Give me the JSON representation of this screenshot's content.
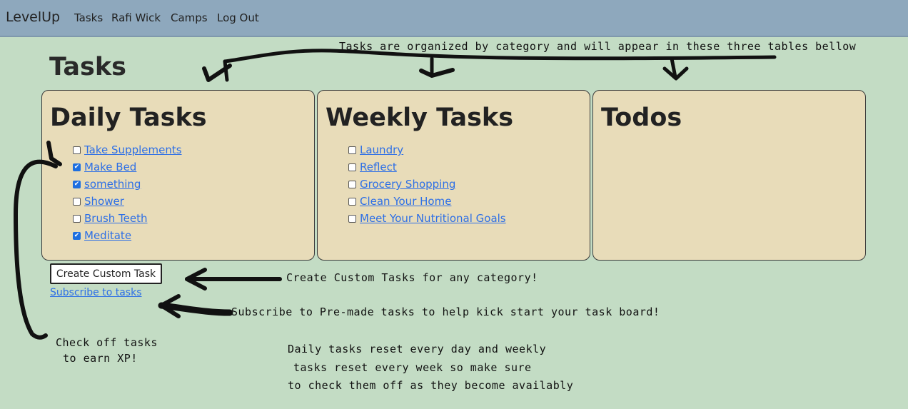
{
  "navbar": {
    "brand": "LevelUp",
    "links": [
      "Tasks",
      "Rafi Wick",
      "Camps",
      "Log Out"
    ]
  },
  "page": {
    "title": "Tasks"
  },
  "panels": {
    "daily": {
      "title": "Daily Tasks",
      "tasks": [
        {
          "label": "Take Supplements",
          "checked": false
        },
        {
          "label": "Make Bed",
          "checked": true
        },
        {
          "label": "something",
          "checked": true
        },
        {
          "label": "Shower",
          "checked": false
        },
        {
          "label": "Brush Teeth",
          "checked": false
        },
        {
          "label": "Meditate",
          "checked": true
        }
      ]
    },
    "weekly": {
      "title": "Weekly Tasks",
      "tasks": [
        {
          "label": "Laundry",
          "checked": false
        },
        {
          "label": "Reflect",
          "checked": false
        },
        {
          "label": "Grocery Shopping",
          "checked": false
        },
        {
          "label": "Clean Your Home",
          "checked": false
        },
        {
          "label": "Meet Your Nutritional Goals",
          "checked": false
        }
      ]
    },
    "todos": {
      "title": "Todos",
      "tasks": []
    }
  },
  "actions": {
    "create_label": "Create Custom Task",
    "subscribe_label": "Subscribe to tasks"
  },
  "annotations": {
    "top": "Tasks are organized by category and will appear in these three tables bellow",
    "create": "Create Custom Tasks for any category!",
    "subscribe": "Subscribe to Pre-made tasks to help kick start your task board!",
    "checkoff": [
      "Check off tasks",
      "to earn XP!"
    ],
    "reset": [
      "Daily tasks reset every day and weekly",
      "tasks reset every week so make sure",
      "to check them off as they become availably"
    ]
  }
}
